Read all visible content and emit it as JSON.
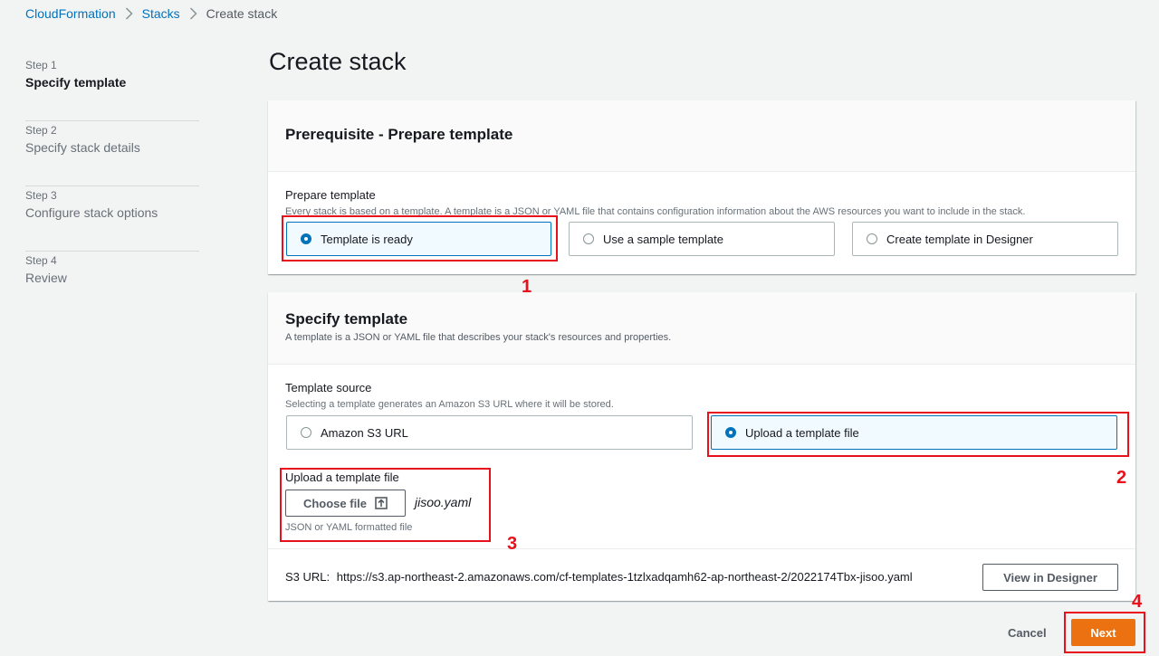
{
  "breadcrumb": {
    "service": "CloudFormation",
    "section": "Stacks",
    "current": "Create stack"
  },
  "steps": [
    {
      "num": "Step 1",
      "label": "Specify template"
    },
    {
      "num": "Step 2",
      "label": "Specify stack details"
    },
    {
      "num": "Step 3",
      "label": "Configure stack options"
    },
    {
      "num": "Step 4",
      "label": "Review"
    }
  ],
  "page_title": "Create stack",
  "prereq": {
    "heading": "Prerequisite - Prepare template",
    "field_label": "Prepare template",
    "field_desc": "Every stack is based on a template. A template is a JSON or YAML file that contains configuration information about the AWS resources you want to include in the stack.",
    "options": [
      "Template is ready",
      "Use a sample template",
      "Create template in Designer"
    ],
    "selected": "Template is ready"
  },
  "specify": {
    "heading": "Specify template",
    "desc": "A template is a JSON or YAML file that describes your stack's resources and properties.",
    "source_label": "Template source",
    "source_desc": "Selecting a template generates an Amazon S3 URL where it will be stored.",
    "options": [
      "Amazon S3 URL",
      "Upload a template file"
    ],
    "selected": "Upload a template file",
    "upload_label": "Upload a template file",
    "choose_file": "Choose file",
    "file_name": "jisoo.yaml",
    "upload_hint": "JSON or YAML formatted file",
    "s3_label": "S3 URL:",
    "s3_url": "https://s3.ap-northeast-2.amazonaws.com/cf-templates-1tzlxadqamh62-ap-northeast-2/2022174Tbx-jisoo.yaml",
    "view_designer": "View in Designer"
  },
  "footer": {
    "cancel": "Cancel",
    "next": "Next"
  },
  "annotations": [
    "1",
    "2",
    "3",
    "4"
  ],
  "colors": {
    "accent": "#0073bb",
    "primary_button": "#ec7211",
    "annotation": "#e8101b"
  },
  "icons": [
    "chevron-right-icon",
    "upload-icon"
  ]
}
